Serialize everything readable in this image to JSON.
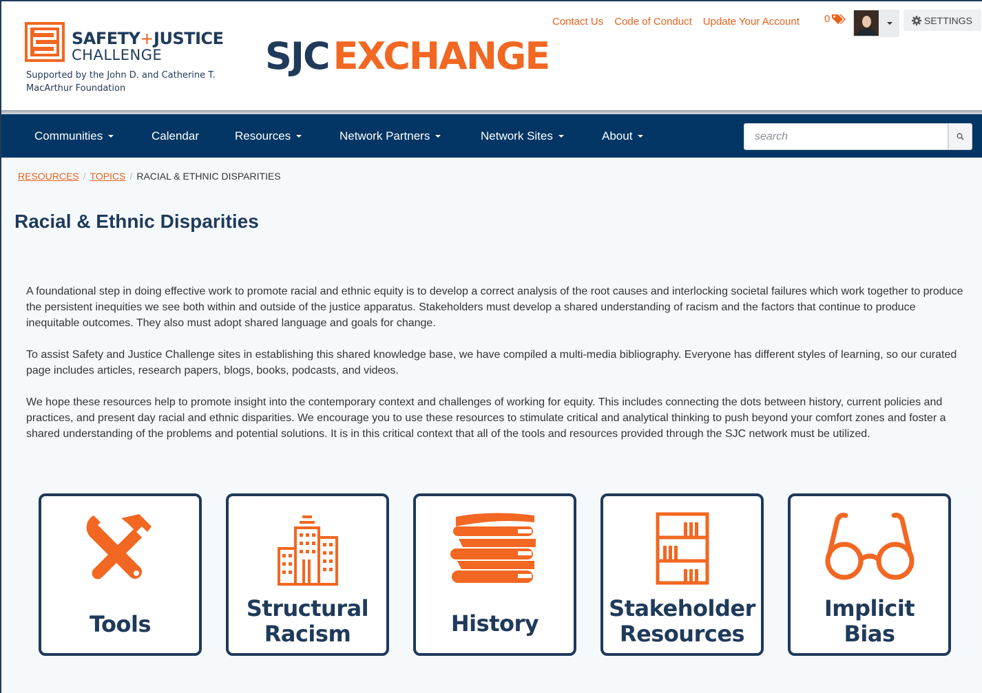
{
  "header": {
    "logo": {
      "title_left": "SAFETY",
      "title_plus": "+",
      "title_right": "JUSTICE",
      "subtitle": "CHALLENGE",
      "support_text": "Supported by the John D. and Catherine T. MacArthur Foundation"
    },
    "brand": {
      "left": "SJC",
      "right": "EXCHANGE"
    },
    "links": [
      "Contact Us",
      "Code of Conduct",
      "Update Your Account"
    ],
    "cart_count": "0",
    "settings_label": "SETTINGS",
    "colors": {
      "navy": "#1f3a5a",
      "orange": "#f26722",
      "nav_bg": "#033664"
    }
  },
  "nav": {
    "items": [
      {
        "label": "Communities",
        "has_dropdown": true
      },
      {
        "label": "Calendar",
        "has_dropdown": false
      },
      {
        "label": "Resources",
        "has_dropdown": true
      },
      {
        "label": "Network Partners",
        "has_dropdown": true
      },
      {
        "label": "Network Sites",
        "has_dropdown": true
      },
      {
        "label": "About",
        "has_dropdown": true
      }
    ],
    "search_placeholder": "search"
  },
  "breadcrumb": {
    "items": [
      "RESOURCES",
      "TOPICS"
    ],
    "current": "RACIAL & ETHNIC DISPARITIES"
  },
  "page": {
    "title": "Racial & Ethnic Disparities",
    "paragraphs": [
      "A foundational step in doing effective work to promote racial and ethnic equity is to develop a correct analysis of the root causes and interlocking societal failures which work together to produce the persistent inequities we see both within and outside of the justice apparatus. Stakeholders must develop a shared understanding of racism and the factors that continue to produce inequitable outcomes. They also must adopt shared language and goals for change.",
      "To assist Safety and Justice Challenge sites in establishing this shared knowledge base, we have compiled a multi-media bibliography. Everyone has different styles of learning, so our curated page includes articles, research papers, blogs, books, podcasts, and videos.",
      "We hope these resources help to promote insight into the contemporary context and challenges of working for equity. This includes connecting the dots between history, current policies and practices, and present day racial and ethnic disparities. We encourage you to use these resources to stimulate critical and analytical thinking to push beyond your comfort zones and foster a shared understanding of the problems and potential solutions. It is in this critical context that all of the tools and resources provided through the SJC network must be utilized."
    ]
  },
  "tiles": [
    {
      "icon": "tools-icon",
      "line1": "Tools",
      "line2": ""
    },
    {
      "icon": "buildings-icon",
      "line1": "Structural",
      "line2": "Racism"
    },
    {
      "icon": "books-icon",
      "line1": "History",
      "line2": ""
    },
    {
      "icon": "bookshelf-icon",
      "line1": "Stakeholder",
      "line2": "Resources"
    },
    {
      "icon": "glasses-icon",
      "line1": "Implicit",
      "line2": "Bias"
    }
  ]
}
